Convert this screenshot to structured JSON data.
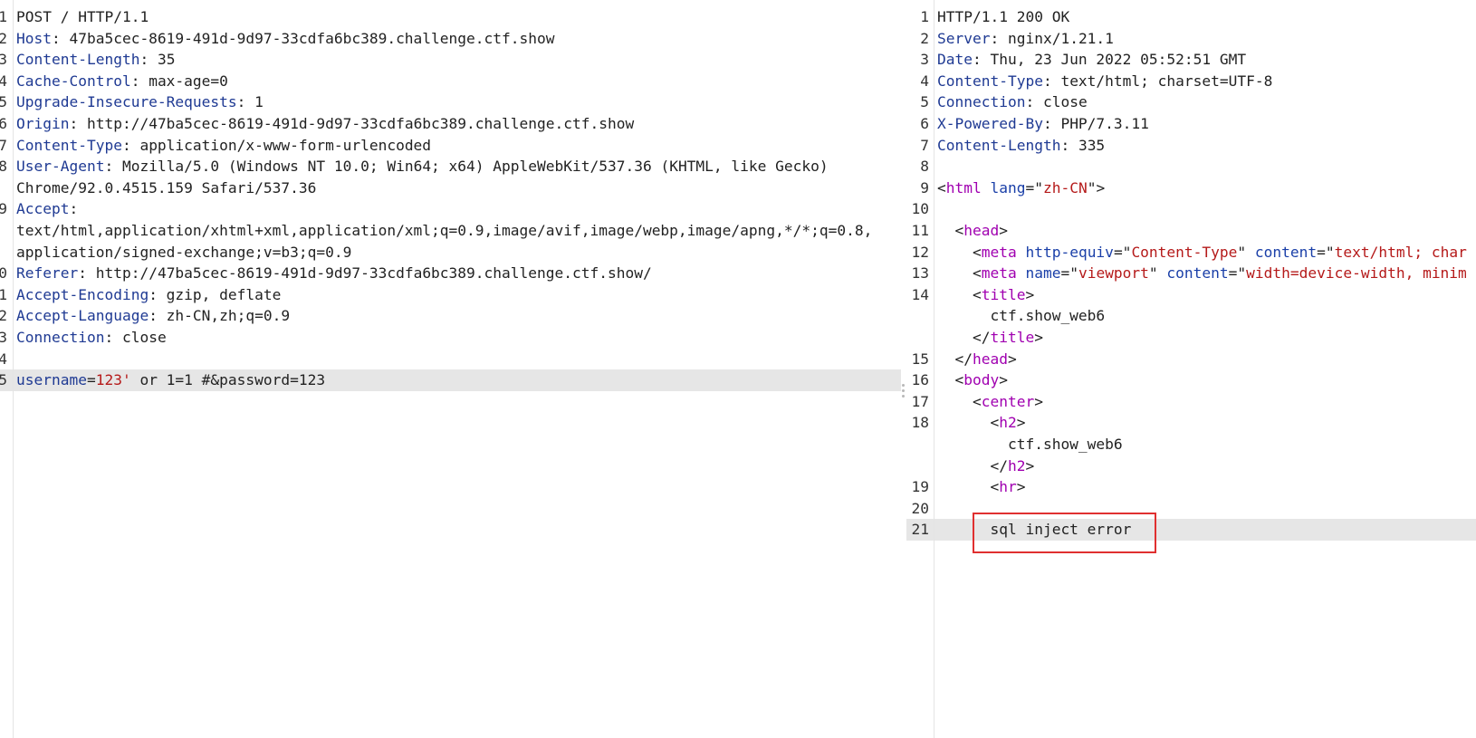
{
  "request": {
    "lines": [
      {
        "num": "1",
        "parts": [
          {
            "t": "POST / HTTP/1.1",
            "c": ""
          }
        ]
      },
      {
        "num": "2",
        "parts": [
          {
            "t": "Host",
            "c": "k"
          },
          {
            "t": ": 47ba5cec-8619-491d-9d97-33cdfa6bc389.challenge.ctf.show",
            "c": ""
          }
        ]
      },
      {
        "num": "3",
        "parts": [
          {
            "t": "Content-Length",
            "c": "k"
          },
          {
            "t": ": 35",
            "c": ""
          }
        ]
      },
      {
        "num": "4",
        "parts": [
          {
            "t": "Cache-Control",
            "c": "k"
          },
          {
            "t": ": max-age=0",
            "c": ""
          }
        ]
      },
      {
        "num": "5",
        "parts": [
          {
            "t": "Upgrade-Insecure-Requests",
            "c": "k"
          },
          {
            "t": ": 1",
            "c": ""
          }
        ]
      },
      {
        "num": "6",
        "parts": [
          {
            "t": "Origin",
            "c": "k"
          },
          {
            "t": ": http://47ba5cec-8619-491d-9d97-33cdfa6bc389.challenge.ctf.show",
            "c": ""
          }
        ]
      },
      {
        "num": "7",
        "parts": [
          {
            "t": "Content-Type",
            "c": "k"
          },
          {
            "t": ": application/x-www-form-urlencoded",
            "c": ""
          }
        ]
      },
      {
        "num": "8",
        "parts": [
          {
            "t": "User-Agent",
            "c": "k"
          },
          {
            "t": ": Mozilla/5.0 (Windows NT 10.0; Win64; x64) AppleWebKit/537.36 (KHTML, like Gecko)",
            "c": ""
          }
        ]
      },
      {
        "num": "",
        "parts": [
          {
            "t": "Chrome/92.0.4515.159 Safari/537.36",
            "c": ""
          }
        ]
      },
      {
        "num": "9",
        "parts": [
          {
            "t": "Accept",
            "c": "k"
          },
          {
            "t": ":",
            "c": ""
          }
        ]
      },
      {
        "num": "",
        "parts": [
          {
            "t": "text/html,application/xhtml+xml,application/xml;q=0.9,image/avif,image/webp,image/apng,*/*;q=0.8,",
            "c": ""
          }
        ]
      },
      {
        "num": "",
        "parts": [
          {
            "t": "application/signed-exchange;v=b3;q=0.9",
            "c": ""
          }
        ]
      },
      {
        "num": "0",
        "parts": [
          {
            "t": "Referer",
            "c": "k"
          },
          {
            "t": ": http://47ba5cec-8619-491d-9d97-33cdfa6bc389.challenge.ctf.show/",
            "c": ""
          }
        ]
      },
      {
        "num": "1",
        "parts": [
          {
            "t": "Accept-Encoding",
            "c": "k"
          },
          {
            "t": ": gzip, deflate",
            "c": ""
          }
        ]
      },
      {
        "num": "2",
        "parts": [
          {
            "t": "Accept-Language",
            "c": "k"
          },
          {
            "t": ": zh-CN,zh;q=0.9",
            "c": ""
          }
        ]
      },
      {
        "num": "3",
        "parts": [
          {
            "t": "Connection",
            "c": "k"
          },
          {
            "t": ": close",
            "c": ""
          }
        ]
      },
      {
        "num": "4",
        "parts": [
          {
            "t": "",
            "c": ""
          }
        ]
      },
      {
        "num": "5",
        "highlight": true,
        "parts": [
          {
            "t": "username",
            "c": "k"
          },
          {
            "t": "=",
            "c": ""
          },
          {
            "t": "123'",
            "c": "hi-val"
          },
          {
            "t": " or 1=1 #&password=123",
            "c": ""
          }
        ]
      }
    ]
  },
  "response": {
    "lines": [
      {
        "num": "1",
        "parts": [
          {
            "t": "HTTP/1.1 200 OK",
            "c": ""
          }
        ]
      },
      {
        "num": "2",
        "parts": [
          {
            "t": "Server",
            "c": "k"
          },
          {
            "t": ": nginx/1.21.1",
            "c": ""
          }
        ]
      },
      {
        "num": "3",
        "parts": [
          {
            "t": "Date",
            "c": "k"
          },
          {
            "t": ": Thu, 23 Jun 2022 05:52:51 GMT",
            "c": ""
          }
        ]
      },
      {
        "num": "4",
        "parts": [
          {
            "t": "Content-Type",
            "c": "k"
          },
          {
            "t": ": text/html; charset=UTF-8",
            "c": ""
          }
        ]
      },
      {
        "num": "5",
        "parts": [
          {
            "t": "Connection",
            "c": "k"
          },
          {
            "t": ": close",
            "c": ""
          }
        ]
      },
      {
        "num": "6",
        "parts": [
          {
            "t": "X-Powered-By",
            "c": "k"
          },
          {
            "t": ": PHP/7.3.11",
            "c": ""
          }
        ]
      },
      {
        "num": "7",
        "parts": [
          {
            "t": "Content-Length",
            "c": "k"
          },
          {
            "t": ": 335",
            "c": ""
          }
        ]
      },
      {
        "num": "8",
        "parts": [
          {
            "t": "",
            "c": ""
          }
        ]
      },
      {
        "num": "9",
        "parts": [
          {
            "t": "<",
            "c": ""
          },
          {
            "t": "html",
            "c": "tg"
          },
          {
            "t": " ",
            "c": ""
          },
          {
            "t": "lang",
            "c": "at"
          },
          {
            "t": "=\"",
            "c": ""
          },
          {
            "t": "zh-CN",
            "c": "vl"
          },
          {
            "t": "\">",
            "c": ""
          }
        ]
      },
      {
        "num": "10",
        "parts": [
          {
            "t": "",
            "c": ""
          }
        ]
      },
      {
        "num": "11",
        "parts": [
          {
            "t": "  <",
            "c": ""
          },
          {
            "t": "head",
            "c": "tg"
          },
          {
            "t": ">",
            "c": ""
          }
        ]
      },
      {
        "num": "12",
        "parts": [
          {
            "t": "    <",
            "c": ""
          },
          {
            "t": "meta",
            "c": "tg"
          },
          {
            "t": " ",
            "c": ""
          },
          {
            "t": "http-equiv",
            "c": "at"
          },
          {
            "t": "=\"",
            "c": ""
          },
          {
            "t": "Content-Type",
            "c": "vl"
          },
          {
            "t": "\" ",
            "c": ""
          },
          {
            "t": "content",
            "c": "at"
          },
          {
            "t": "=\"",
            "c": ""
          },
          {
            "t": "text/html; char",
            "c": "vl"
          }
        ]
      },
      {
        "num": "13",
        "parts": [
          {
            "t": "    <",
            "c": ""
          },
          {
            "t": "meta",
            "c": "tg"
          },
          {
            "t": " ",
            "c": ""
          },
          {
            "t": "name",
            "c": "at"
          },
          {
            "t": "=\"",
            "c": ""
          },
          {
            "t": "viewport",
            "c": "vl"
          },
          {
            "t": "\" ",
            "c": ""
          },
          {
            "t": "content",
            "c": "at"
          },
          {
            "t": "=\"",
            "c": ""
          },
          {
            "t": "width=device-width, minim",
            "c": "vl"
          }
        ]
      },
      {
        "num": "14",
        "parts": [
          {
            "t": "    <",
            "c": ""
          },
          {
            "t": "title",
            "c": "tg"
          },
          {
            "t": ">",
            "c": ""
          }
        ]
      },
      {
        "num": "",
        "parts": [
          {
            "t": "      ctf.show_web6",
            "c": ""
          }
        ]
      },
      {
        "num": "",
        "parts": [
          {
            "t": "    </",
            "c": ""
          },
          {
            "t": "title",
            "c": "tg"
          },
          {
            "t": ">",
            "c": ""
          }
        ]
      },
      {
        "num": "15",
        "parts": [
          {
            "t": "  </",
            "c": ""
          },
          {
            "t": "head",
            "c": "tg"
          },
          {
            "t": ">",
            "c": ""
          }
        ]
      },
      {
        "num": "16",
        "parts": [
          {
            "t": "  <",
            "c": ""
          },
          {
            "t": "body",
            "c": "tg"
          },
          {
            "t": ">",
            "c": ""
          }
        ]
      },
      {
        "num": "17",
        "parts": [
          {
            "t": "    <",
            "c": ""
          },
          {
            "t": "center",
            "c": "tg"
          },
          {
            "t": ">",
            "c": ""
          }
        ]
      },
      {
        "num": "18",
        "parts": [
          {
            "t": "      <",
            "c": ""
          },
          {
            "t": "h2",
            "c": "tg"
          },
          {
            "t": ">",
            "c": ""
          }
        ]
      },
      {
        "num": "",
        "parts": [
          {
            "t": "        ctf.show_web6",
            "c": ""
          }
        ]
      },
      {
        "num": "",
        "parts": [
          {
            "t": "      </",
            "c": ""
          },
          {
            "t": "h2",
            "c": "tg"
          },
          {
            "t": ">",
            "c": ""
          }
        ]
      },
      {
        "num": "19",
        "parts": [
          {
            "t": "      <",
            "c": ""
          },
          {
            "t": "hr",
            "c": "tg"
          },
          {
            "t": ">",
            "c": ""
          }
        ]
      },
      {
        "num": "20",
        "parts": [
          {
            "t": "",
            "c": ""
          }
        ]
      },
      {
        "num": "21",
        "highlight": true,
        "parts": [
          {
            "t": "      sql inject error",
            "c": ""
          }
        ]
      }
    ]
  },
  "colors": {
    "header_key": "#1f3a93",
    "html_tag": "#a000b0",
    "html_attr": "#1a3fa8",
    "html_value": "#b51a1a",
    "highlight_line": "#e6e6e6",
    "callout_border": "#e03030"
  }
}
